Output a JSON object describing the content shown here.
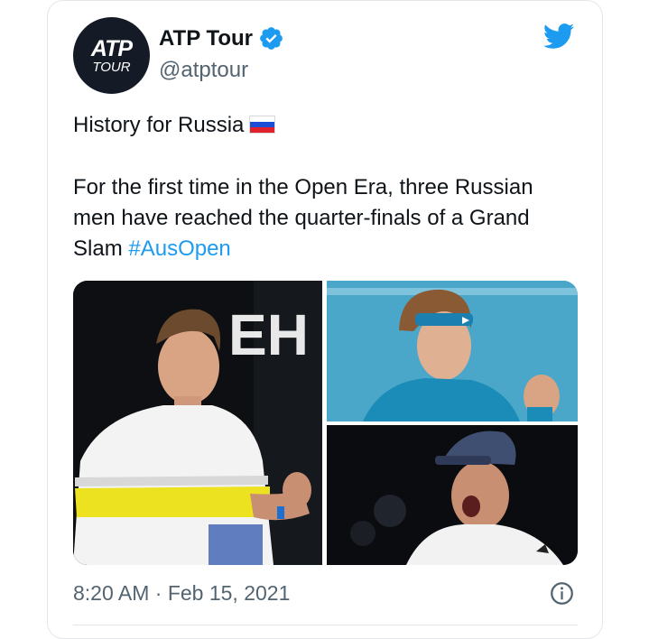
{
  "tweet": {
    "avatar": {
      "logo_line1": "ATP",
      "logo_line2": "TOUR"
    },
    "display_name": "ATP Tour",
    "handle": "@atptour",
    "text_line1": "History for Russia",
    "text_line2": "For the first time in the Open Era, three Russian",
    "text_line3": "men have reached the quarter-finals of a Grand",
    "text_line4_prefix": "Slam ",
    "hashtag": "#AusOpen",
    "media_text": "EH",
    "timestamp": "8:20 AM · Feb 15, 2021"
  },
  "icons": {
    "verified": "verified-badge-icon",
    "bird": "twitter-bird-icon",
    "info": "info-icon",
    "flag": "russia-flag-icon"
  },
  "colors": {
    "accent": "#1d9bf0",
    "text": "#0f1419",
    "secondary": "#536471",
    "border": "#e3e6e8"
  }
}
